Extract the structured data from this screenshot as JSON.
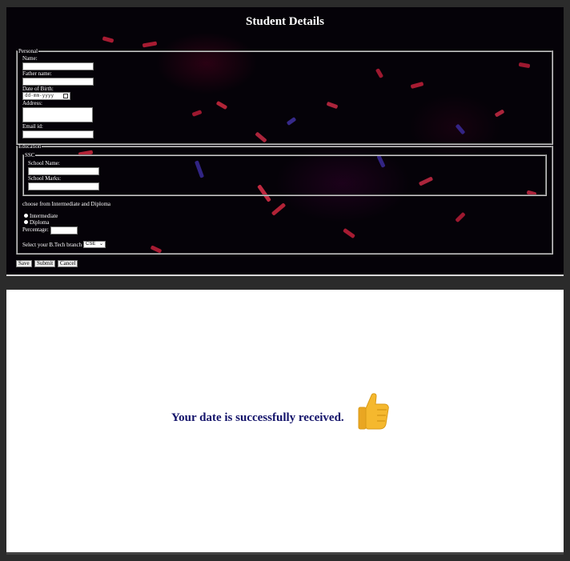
{
  "form": {
    "title": "Student Details",
    "personal": {
      "legend": "Personal",
      "name_label": "Name:",
      "father_label": "Father name:",
      "dob_label": "Date of Birth:",
      "dob_placeholder": "dd-mm-yyyy",
      "address_label": "Address:",
      "email_label": "Email id:"
    },
    "education": {
      "legend": "Education",
      "ssc": {
        "legend": "SSC",
        "school_name_label": "School Name:",
        "school_marks_label": "School Marks:"
      },
      "choose_text": "choose from Intermediate and Diploma",
      "options": [
        "Intermediate",
        "Diploma"
      ],
      "percentage_label": "Percentage:",
      "branch_label": "Select your B.Tech branch",
      "branch_selected": "CSE"
    },
    "buttons": {
      "save": "Save",
      "submit": "Submit",
      "cancel": "Cancel"
    }
  },
  "success": {
    "message": "Your date is successfully received.",
    "icon": "thumbs-up-icon"
  },
  "colors": {
    "background_dark": "#050208",
    "streak_red": "#e0304a",
    "streak_blue": "#3a2a9a",
    "message_color": "#13136a",
    "thumb_color": "#f5b82e"
  }
}
